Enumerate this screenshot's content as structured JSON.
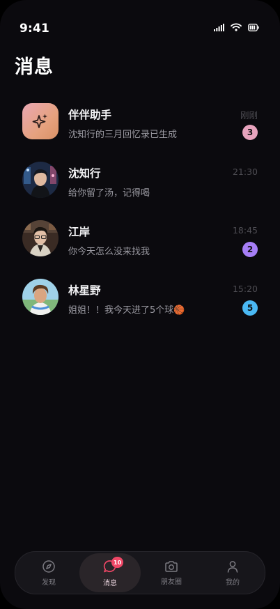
{
  "status_bar": {
    "time": "9:41"
  },
  "page": {
    "title": "消息"
  },
  "conversations": [
    {
      "name": "伴伴助手",
      "preview": "沈知行的三月回忆录已生成",
      "time": "刚刚",
      "unread": "3",
      "badge_color": "#e7a3bd",
      "avatar": "sparkle-icon"
    },
    {
      "name": "沈知行",
      "preview": "给你留了汤，记得喝",
      "time": "21:30",
      "unread": "",
      "badge_color": "",
      "avatar": "avatar-photo"
    },
    {
      "name": "江岸",
      "preview": "你今天怎么没来找我",
      "time": "18:45",
      "unread": "2",
      "badge_color": "#a67ef6",
      "avatar": "avatar-photo"
    },
    {
      "name": "林星野",
      "preview": "姐姐！！我今天进了5个球🏀",
      "time": "15:20",
      "unread": "5",
      "badge_color": "#4ab8f3",
      "avatar": "avatar-photo"
    }
  ],
  "tabbar": {
    "tabs": [
      {
        "label": "发现",
        "icon": "compass-icon",
        "active": false
      },
      {
        "label": "消息",
        "icon": "chat-bubble-icon",
        "active": true,
        "badge": "10"
      },
      {
        "label": "朋友圈",
        "icon": "camera-icon",
        "active": false
      },
      {
        "label": "我的",
        "icon": "user-icon",
        "active": false
      }
    ]
  }
}
